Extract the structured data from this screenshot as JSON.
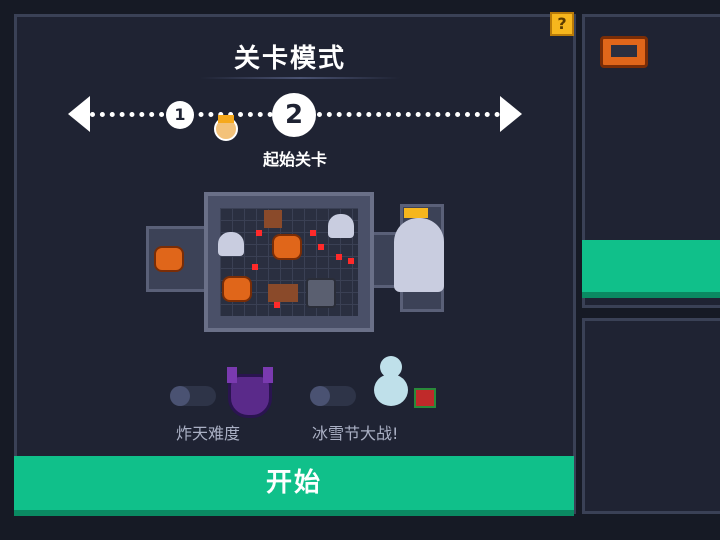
{
  "header": {
    "title": "关卡模式",
    "help_label": "?"
  },
  "stage_track": {
    "nodes": [
      {
        "label": "1",
        "state": "passed"
      },
      {
        "label": "2",
        "state": "selected"
      }
    ],
    "selected_label": "起始关卡",
    "colors": {
      "track": "#ffffff"
    }
  },
  "modes": [
    {
      "label": "炸天难度",
      "enabled": false,
      "icon": "demon-helmet-icon"
    },
    {
      "label": "冰雪节大战!",
      "enabled": false,
      "icon": "snowman-icon"
    }
  ],
  "start_button": {
    "label": "开始"
  },
  "colors": {
    "accent": "#10c08a",
    "panel": "#1f2333",
    "background": "#161a25",
    "help": "#f6b61d"
  }
}
